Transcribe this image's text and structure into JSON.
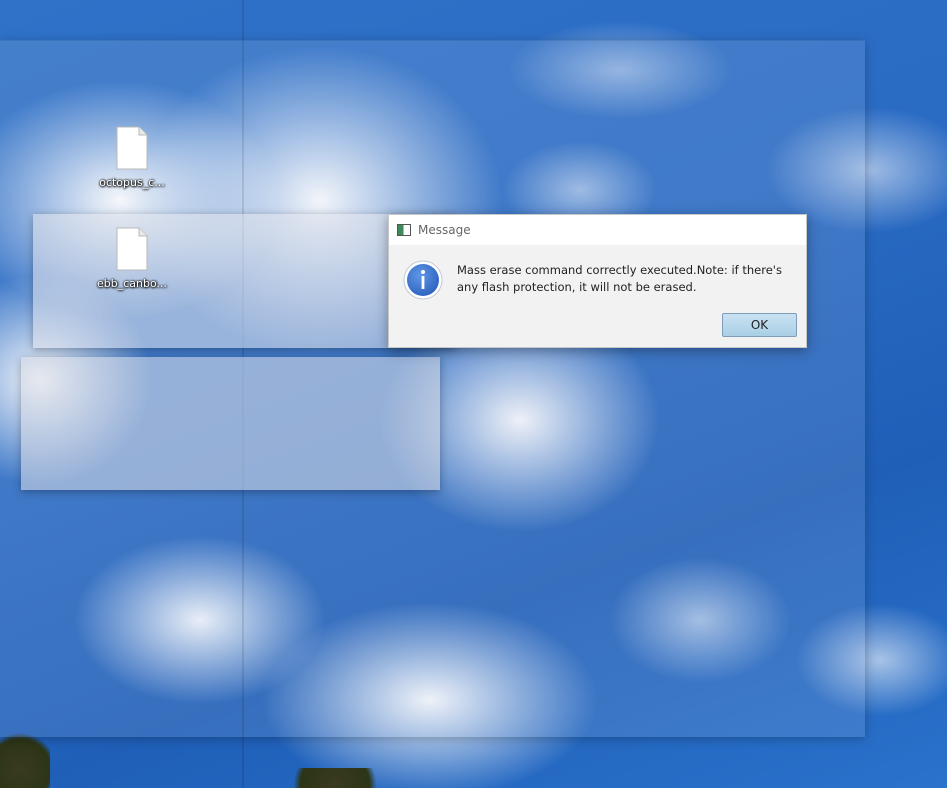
{
  "desktop": {
    "icons": [
      {
        "label": "octopus_c...",
        "icon": "document-icon"
      },
      {
        "label": "ebb_canbo...",
        "icon": "document-icon"
      }
    ]
  },
  "dialog": {
    "title": "Message",
    "icon": "info-icon",
    "message": "Mass erase command correctly executed.Note: if there's any flash protection, it will not be erased.",
    "ok_label": "OK",
    "accent_color": "#3b78d4"
  }
}
